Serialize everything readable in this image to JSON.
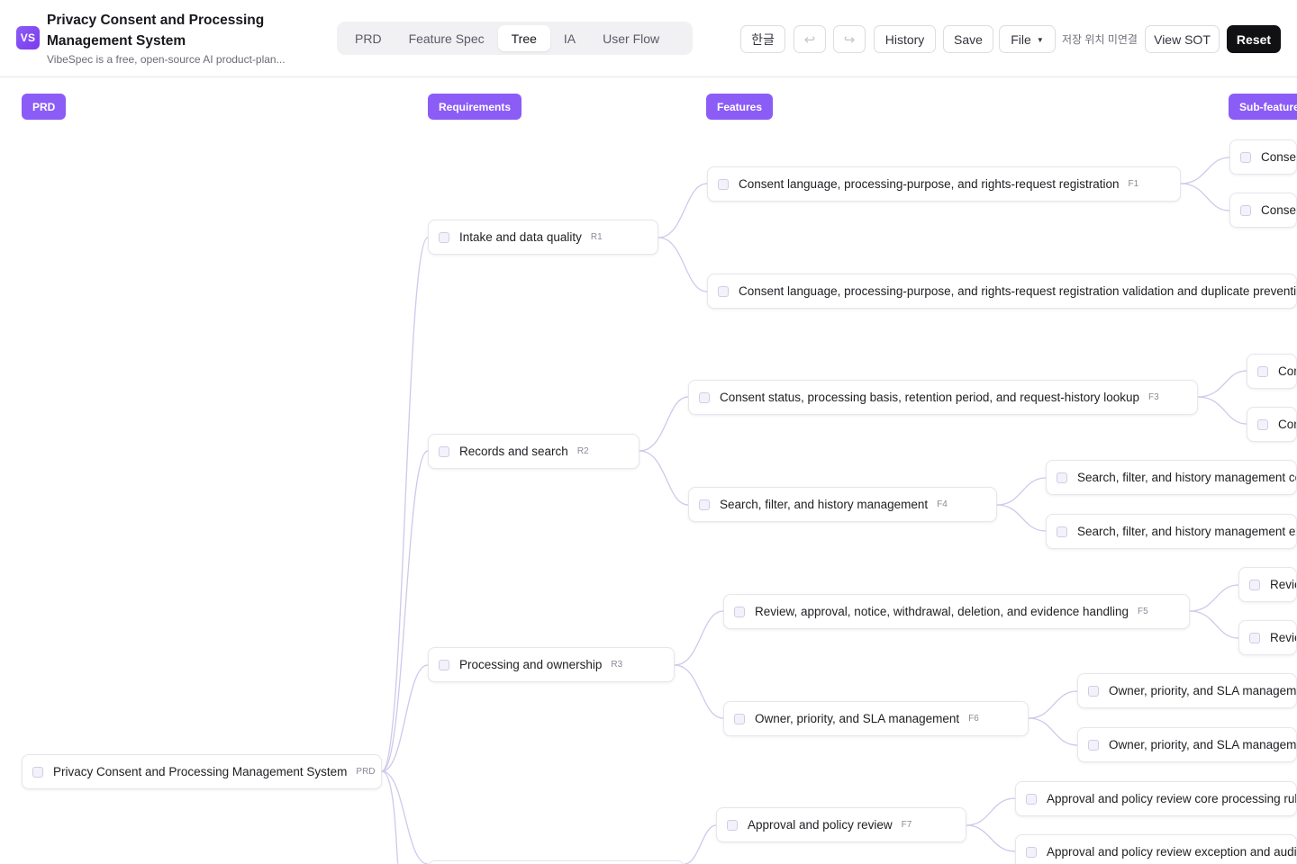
{
  "app": {
    "logo": "VS",
    "title": "Privacy Consent and Processing Management System",
    "subtitle": "VibeSpec is a free, open-source AI product-plan..."
  },
  "tabs": [
    {
      "label": "PRD",
      "active": false
    },
    {
      "label": "Feature Spec",
      "active": false
    },
    {
      "label": "Tree",
      "active": true
    },
    {
      "label": "IA",
      "active": false
    },
    {
      "label": "User Flow",
      "active": false
    }
  ],
  "toolbar": {
    "language": "한글",
    "undo_icon": "↩",
    "redo_icon": "↪",
    "history": "History",
    "save": "Save",
    "file": "File",
    "save_status": "저장 위치 미연결",
    "view_sot": "View SOT",
    "reset": "Reset"
  },
  "columns": [
    "PRD",
    "Requirements",
    "Features",
    "Sub-features"
  ],
  "tree": {
    "root": {
      "label": "Privacy Consent and Processing Management System",
      "code": "PRD"
    },
    "requirements": [
      {
        "label": "Intake and data quality",
        "code": "R1"
      },
      {
        "label": "Records and search",
        "code": "R2"
      },
      {
        "label": "Processing and ownership",
        "code": "R3"
      }
    ],
    "features": [
      {
        "label": "Consent language, processing-purpose, and rights-request registration",
        "code": "F1"
      },
      {
        "label": "Consent language, processing-purpose, and rights-request registration validation and duplicate prevention",
        "code": "F2"
      },
      {
        "label": "Consent status, processing basis, retention period, and request-history lookup",
        "code": "F3"
      },
      {
        "label": "Search, filter, and history management",
        "code": "F4"
      },
      {
        "label": "Review, approval, notice, withdrawal, deletion, and evidence handling",
        "code": "F5"
      },
      {
        "label": "Owner, priority, and SLA management",
        "code": "F6"
      },
      {
        "label": "Approval and policy review",
        "code": "F7"
      }
    ],
    "subfeatures": [
      {
        "label": "Consent language, processing-purpose, and rights-request registration core processing rule"
      },
      {
        "label": "Consent language, processing-purpose, and rights-request registration exception and audit handling"
      },
      {
        "label": "Consent status, processing basis, retention period, and request-history lookup core processing rule"
      },
      {
        "label": "Consent status, processing basis, retention period, and request-history lookup exception and audit handling"
      },
      {
        "label": "Search, filter, and history management core processing rule"
      },
      {
        "label": "Search, filter, and history management exception and audit handling"
      },
      {
        "label": "Review, approval, notice, withdrawal, deletion, and evidence handling core processing rule"
      },
      {
        "label": "Review, approval, notice, withdrawal, deletion, and evidence handling exception and audit handling"
      },
      {
        "label": "Owner, priority, and SLA management core processing rule"
      },
      {
        "label": "Owner, priority, and SLA management exception and audit handling"
      },
      {
        "label": "Approval and policy review core processing rule"
      },
      {
        "label": "Approval and policy review exception and audit handling"
      }
    ]
  }
}
